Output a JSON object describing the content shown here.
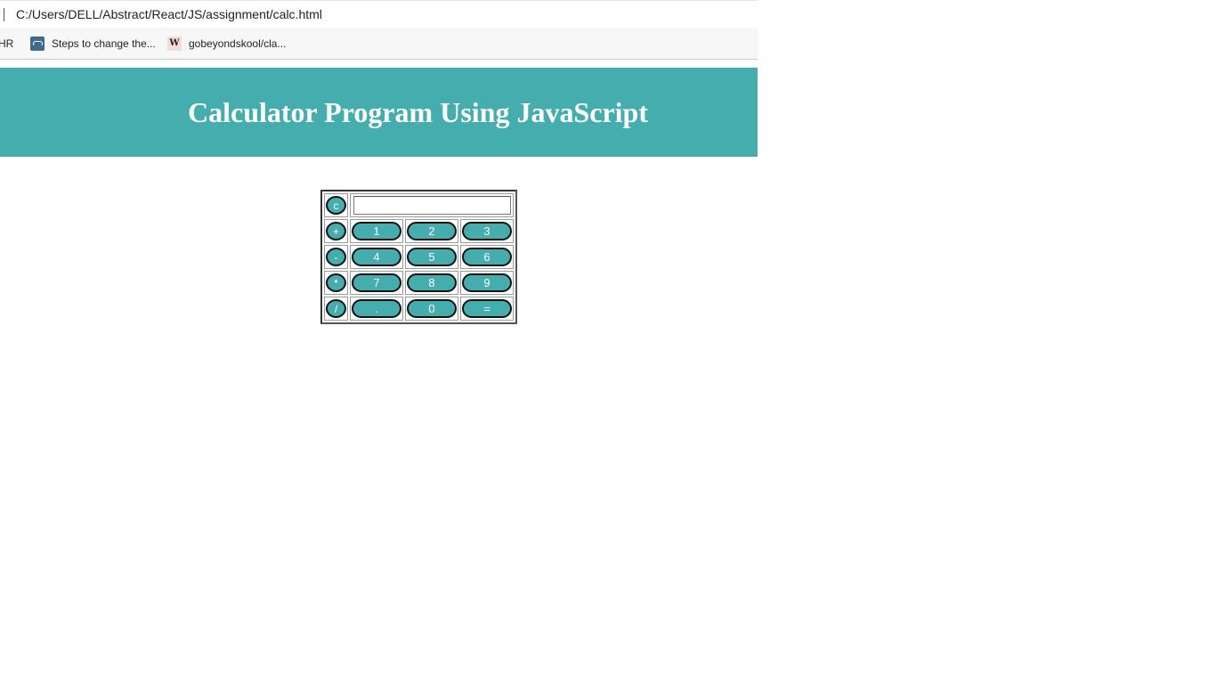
{
  "address_bar": {
    "url": "C:/Users/DELL/Abstract/React/JS/assignment/calc.html"
  },
  "bookmarks": [
    {
      "label": "HR",
      "icon": ""
    },
    {
      "label": "Steps to change the...",
      "icon": "link-icon"
    },
    {
      "label": "gobeyondskool/cla...",
      "icon": "w-icon",
      "icon_text": "W"
    }
  ],
  "header": {
    "title": "Calculator Program Using JavaScript",
    "bg_color": "#44adad"
  },
  "calculator": {
    "display_value": "",
    "clear_label": "c",
    "operators": [
      "+",
      "-",
      "*",
      "/"
    ],
    "rows": [
      [
        "1",
        "2",
        "3"
      ],
      [
        "4",
        "5",
        "6"
      ],
      [
        "7",
        "8",
        "9"
      ],
      [
        ".",
        "0",
        "="
      ]
    ],
    "button_color": "#44adad"
  }
}
